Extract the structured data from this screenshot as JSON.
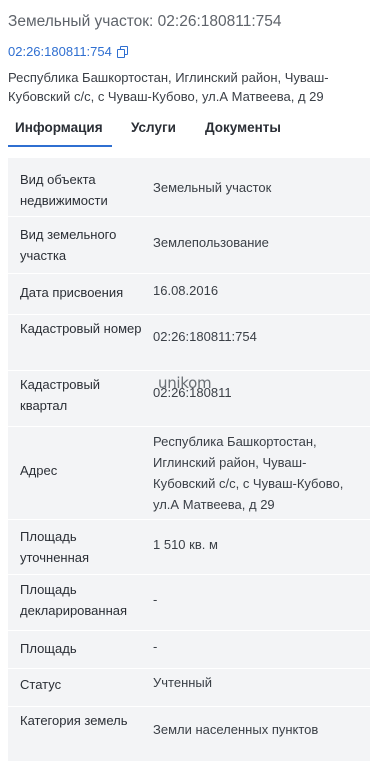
{
  "title": "Земельный участок: 02:26:180811:754",
  "cadastral_link": "02:26:180811:754",
  "address_full": "Республика Башкортостан, Иглинский район, Чуваш-Кубовский с/с, с Чуваш-Кубово, ул.А Матвеева, д 29",
  "tabs": [
    {
      "label": "Информация",
      "active": true
    },
    {
      "label": "Услуги",
      "active": false
    },
    {
      "label": "Документы",
      "active": false
    }
  ],
  "watermark": "unikom",
  "accent_color": "#2f6fd1",
  "icons": {
    "copy": "copy-icon"
  },
  "rows": [
    {
      "label": "Вид объекта недвижимости",
      "value": "Земельный участок"
    },
    {
      "label": "Вид земельного участка",
      "value": "Землепользование"
    },
    {
      "label": "Дата присвоения",
      "value": "16.08.2016"
    },
    {
      "label": "Кадастровый номер",
      "value": "02:26:180811:754"
    },
    {
      "label": "Кадастровый квартал",
      "value": "02:26:180811"
    },
    {
      "label": "Адрес",
      "value": "Республика Башкортостан, Иглинский район, Чуваш-Кубовский с/с, с Чуваш-Кубово, ул.А Матвеева, д 29"
    },
    {
      "label": "Площадь уточненная",
      "value": "1 510 кв. м"
    },
    {
      "label": "Площадь декларированная",
      "value": "-"
    },
    {
      "label": "Площадь",
      "value": "-"
    },
    {
      "label": "Статус",
      "value": "Учтенный"
    },
    {
      "label": "Категория земель",
      "value": "Земли населенных пунктов"
    }
  ]
}
